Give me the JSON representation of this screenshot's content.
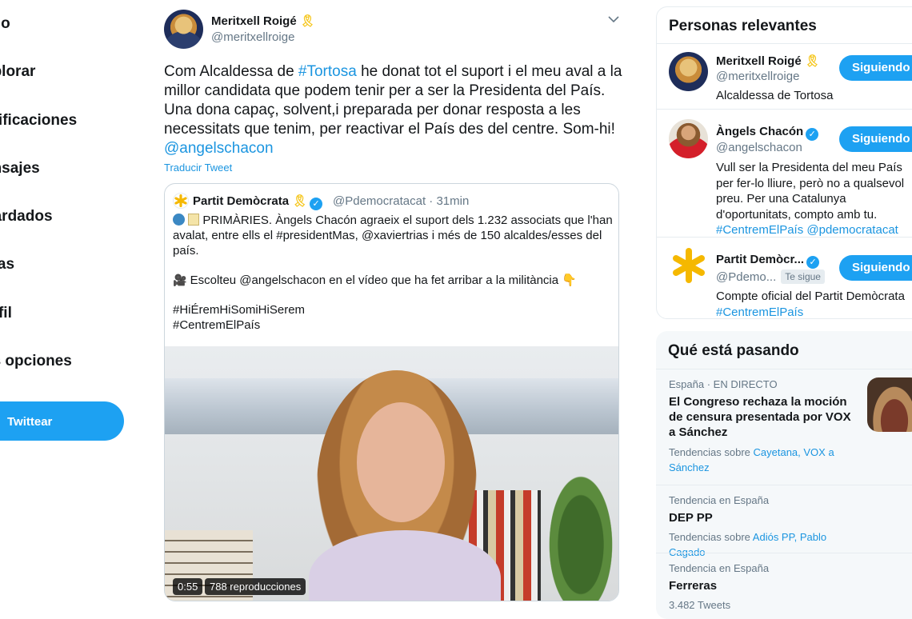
{
  "nav": {
    "items": [
      "icio",
      "xplorar",
      "otificaciones",
      "ensajes",
      "uardados",
      "stas",
      "erfil",
      "ás opciones"
    ],
    "tweet_button": "Twittear"
  },
  "tweet": {
    "author_name": "Meritxell Roigé",
    "author_handle": "@meritxellroige",
    "text_parts": [
      "Com Alcaldessa de ",
      "#Tortosa",
      " he donat tot el suport i el meu aval a la millor candidata que podem tenir per a ser la Presidenta del País. Una dona capaç, solvent,i preparada per donar resposta a les necessitats que tenim, per reactivar el País des del centre. Som-hi!",
      "@angelschacon"
    ],
    "translate": "Traducir Tweet",
    "quote": {
      "name": "Partit Demòcrata",
      "handle": "@Pdemocratacat · 31min",
      "line1": "PRIMÀRIES. Àngels Chacón agraeix el suport dels 1.232 associats que l'han avalat, entre ells el #presidentMas, @xaviertrias i més de 150 alcaldes/esses del país.",
      "line2": "Escolteu @angelschacon en el vídeo que ha fet arribar a la militància",
      "line3": "#HiÉremHiSomiHiSerem",
      "line4": "#CentremElPaís",
      "video_time": "0:55",
      "video_views": "788 reproducciones"
    }
  },
  "people": {
    "title": "Personas relevantes",
    "list": [
      {
        "name": "Meritxell Roigé",
        "handle": "@meritxellroige",
        "bio": "Alcaldessa de Tortosa",
        "button": "Siguiendo"
      },
      {
        "name": "Àngels Chacón",
        "handle": "@angelschacon",
        "bio_text": "Vull ser la Presidenta del meu País per fer-lo lliure, però no a qualsevol preu. Per una Catalunya d'oportunitats, compto amb tu.",
        "bio_links": "#CentremElPaís @pdemocratacat",
        "button": "Siguiendo"
      },
      {
        "name": "Partit Demòcr...",
        "handle": "@Pdemo...",
        "follows_you": "Te sigue",
        "bio": "Compte oficial del Partit Demòcrata",
        "bio_link": "#CentremElPaís",
        "button": "Siguiendo"
      }
    ]
  },
  "trends": {
    "title": "Qué está pasando",
    "list": [
      {
        "meta": "España · EN DIRECTO",
        "title": "El Congreso rechaza la moción de censura presentada por VOX a Sánchez",
        "sub_prefix": "Tendencias sobre ",
        "sub_links": "Cayetana, VOX a Sánchez"
      },
      {
        "meta": "Tendencia en España",
        "title": "DEP PP",
        "sub_prefix": "Tendencias sobre ",
        "sub_links": "Adiós PP, Pablo Cagado"
      },
      {
        "meta": "Tendencia en España",
        "title": "Ferreras",
        "sub": "3.482 Tweets"
      }
    ]
  },
  "colors": {
    "accent": "#1da1f2",
    "link": "#1b95e0",
    "muted": "#657786",
    "ribbon": "#f5c518"
  }
}
